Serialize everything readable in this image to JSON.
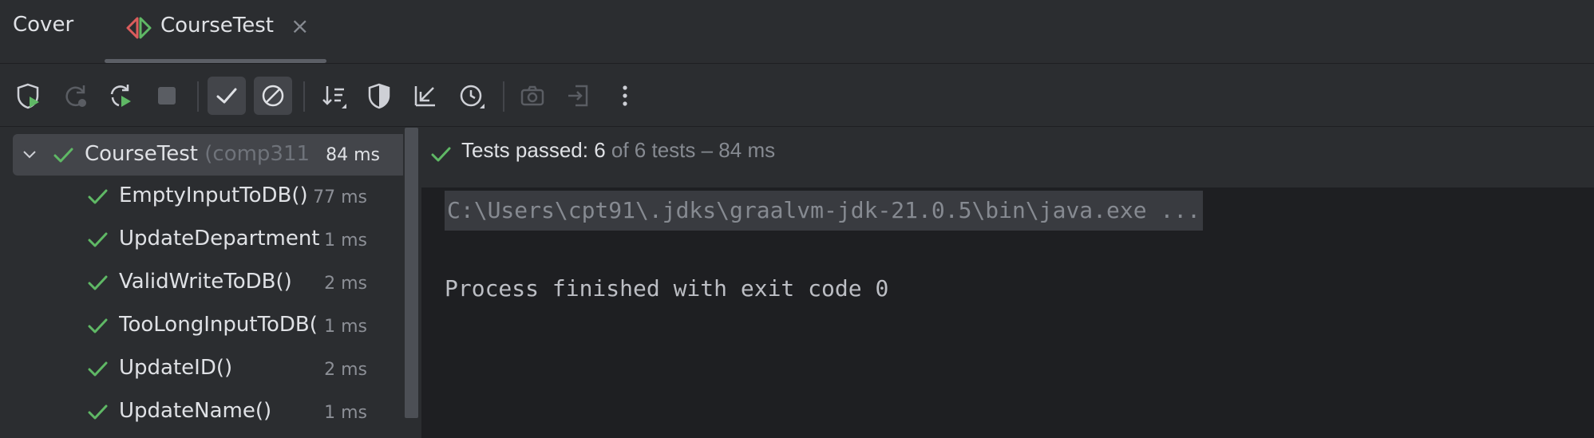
{
  "header": {
    "panel_title": "Cover",
    "tab": {
      "label": "CourseTest",
      "close": "×",
      "icon": "test-run-icon"
    }
  },
  "toolbar": {
    "buttons": [
      "rerun-with-coverage-icon",
      "rerun-failed-icon",
      "toggle-auto-test-icon",
      "stop-icon",
      "show-passed-icon",
      "show-ignored-icon",
      "sort-icon",
      "shield-icon",
      "collapse-icon",
      "history-icon",
      "camera-icon",
      "import-icon",
      "more-icon"
    ]
  },
  "tree": {
    "root": {
      "name": "CourseTest",
      "package": "(comp311",
      "duration": "84 ms"
    },
    "tests": [
      {
        "name": "EmptyInputToDB()",
        "duration": "77 ms"
      },
      {
        "name": "UpdateDepartment(",
        "duration": "1 ms"
      },
      {
        "name": "ValidWriteToDB()",
        "duration": "2 ms"
      },
      {
        "name": "TooLongInputToDB(",
        "duration": "1 ms"
      },
      {
        "name": "UpdateID()",
        "duration": "2 ms"
      },
      {
        "name": "UpdateName()",
        "duration": "1 ms"
      }
    ]
  },
  "status": {
    "prefix": "Tests passed: ",
    "passed": "6",
    "suffix": " of 6 tests – 84 ms"
  },
  "console": {
    "command": "C:\\Users\\cpt91\\.jdks\\graalvm-jdk-21.0.5\\bin\\java.exe ...",
    "output": "Process finished with exit code 0"
  },
  "colors": {
    "background": "#2b2d30",
    "console_bg": "#1e1f22",
    "pass_green": "#5fb865",
    "selection": "#43454a"
  }
}
